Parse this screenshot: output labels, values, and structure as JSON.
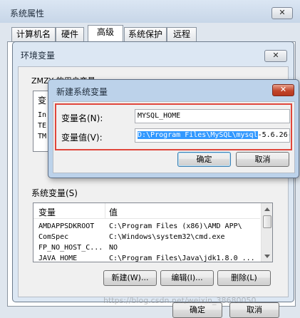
{
  "sysprops": {
    "title": "系统属性",
    "close_glyph": "✕",
    "tabs": [
      "计算机名",
      "硬件",
      "高级",
      "系统保护",
      "远程"
    ],
    "ok_label": "确定",
    "cancel_label": "取消"
  },
  "envvars": {
    "title": "环境变量",
    "close_glyph": "✕",
    "user_section_label": "ZMZY 的用户变量",
    "user_col_var": "变",
    "user_rows": [
      "In",
      "TE",
      "TM"
    ],
    "system_section_label": "系统变量(S)",
    "col_variable": "变量",
    "col_value": "值",
    "system_rows": [
      {
        "name": "AMDAPPSDKROOT",
        "value": "C:\\Program Files (x86)\\AMD APP\\"
      },
      {
        "name": "ComSpec",
        "value": "C:\\Windows\\system32\\cmd.exe"
      },
      {
        "name": "FP_NO_HOST_C...",
        "value": "NO"
      },
      {
        "name": "JAVA_HOME",
        "value": "C:\\Program Files\\Java\\jdk1.8.0_..."
      }
    ],
    "new_label": "新建(W)...",
    "edit_label": "编辑(I)...",
    "delete_label": "删除(L)"
  },
  "newvar": {
    "title": "新建系统变量",
    "close_glyph": "✕",
    "name_label": "变量名(N):",
    "value_label": "变量值(V):",
    "name_value": "MYSQL_HOME",
    "value_selected": "D:\\Program Files\\MySQL\\mysql",
    "value_rest": "-5.6.26-",
    "ok_label": "确定",
    "cancel_label": "取消"
  },
  "watermark": "https://blog.csdn.net/weixin_38680050",
  "colors": {
    "selection": "#3399ff",
    "highlight_border": "#e0463b",
    "title_bar": "#bcd2ea"
  }
}
